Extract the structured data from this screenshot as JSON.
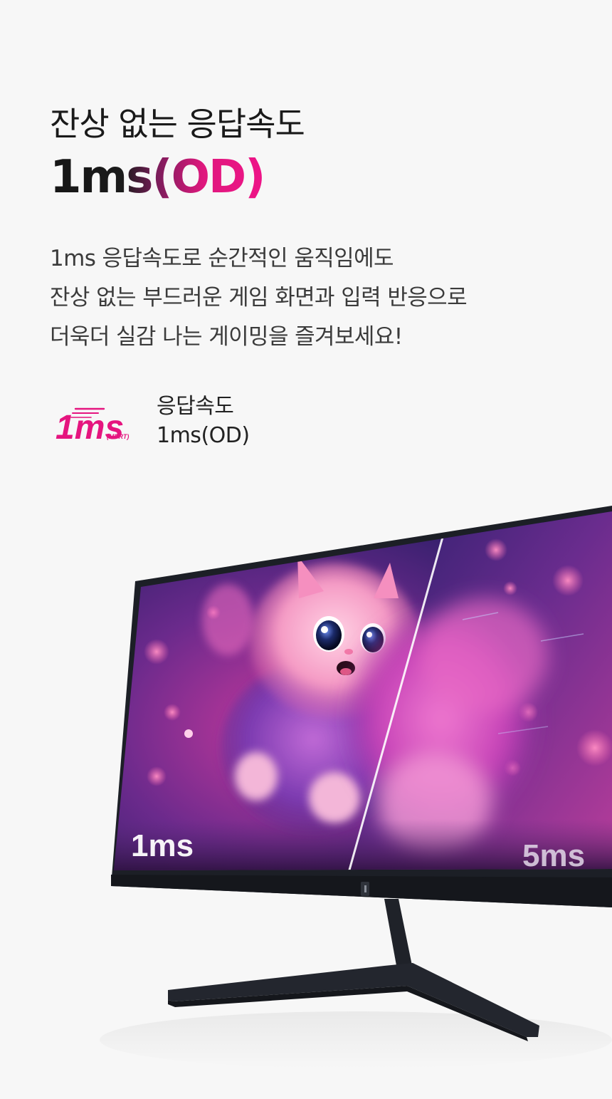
{
  "header": {
    "headline": "잔상 없는 응답속도",
    "spec_headline": "1ms(OD)"
  },
  "description": {
    "lines": [
      "1ms 응답속도로 순간적인 움직임에도",
      "잔상 없는 부드러운 게임 화면과 입력 반응으로",
      "더욱더 실감 나는 게이밍을 즐겨보세요!"
    ]
  },
  "spec": {
    "badge_main": "1ms",
    "badge_sub": "(MPRT)",
    "label": "응답속도",
    "value": "1ms(OD)"
  },
  "comparison": {
    "left_label": "1ms",
    "right_label": "5ms"
  },
  "colors": {
    "accent": "#e5157f",
    "background": "#f7f7f7",
    "bezel": "#1e2128"
  }
}
